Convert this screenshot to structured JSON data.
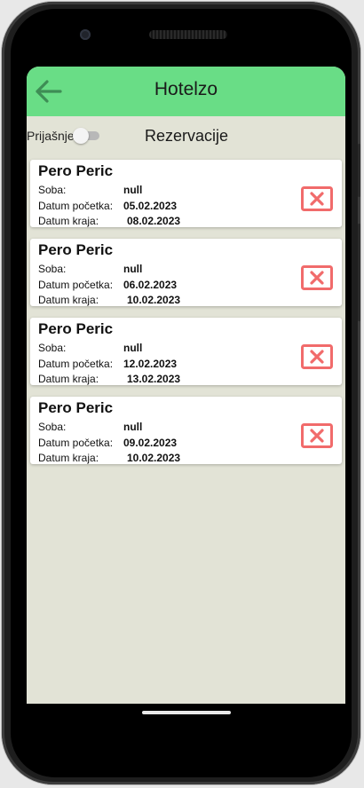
{
  "app": {
    "title": "Hotelzo"
  },
  "filter": {
    "prior_label": "Prijašnje",
    "prior_enabled": false,
    "section_title": "Rezervacije"
  },
  "labels": {
    "room": "Soba:",
    "start": "Datum početka:",
    "end": "Datum kraja:"
  },
  "reservations": [
    {
      "guest": "Pero Peric",
      "room": "null",
      "start": "05.02.2023",
      "end": "08.02.2023"
    },
    {
      "guest": "Pero Peric",
      "room": "null",
      "start": "06.02.2023",
      "end": "10.02.2023"
    },
    {
      "guest": "Pero Peric",
      "room": "null",
      "start": "12.02.2023",
      "end": "13.02.2023"
    },
    {
      "guest": "Pero Peric",
      "room": "null",
      "start": "09.02.2023",
      "end": "10.02.2023"
    }
  ],
  "icons": {
    "back": "arrow-left-icon",
    "delete": "close-box-icon"
  },
  "colors": {
    "appbar": "#69dd86",
    "back_arrow": "#3e8d55",
    "screen_bg": "#e2e3d6",
    "delete": "#f16b6b"
  }
}
